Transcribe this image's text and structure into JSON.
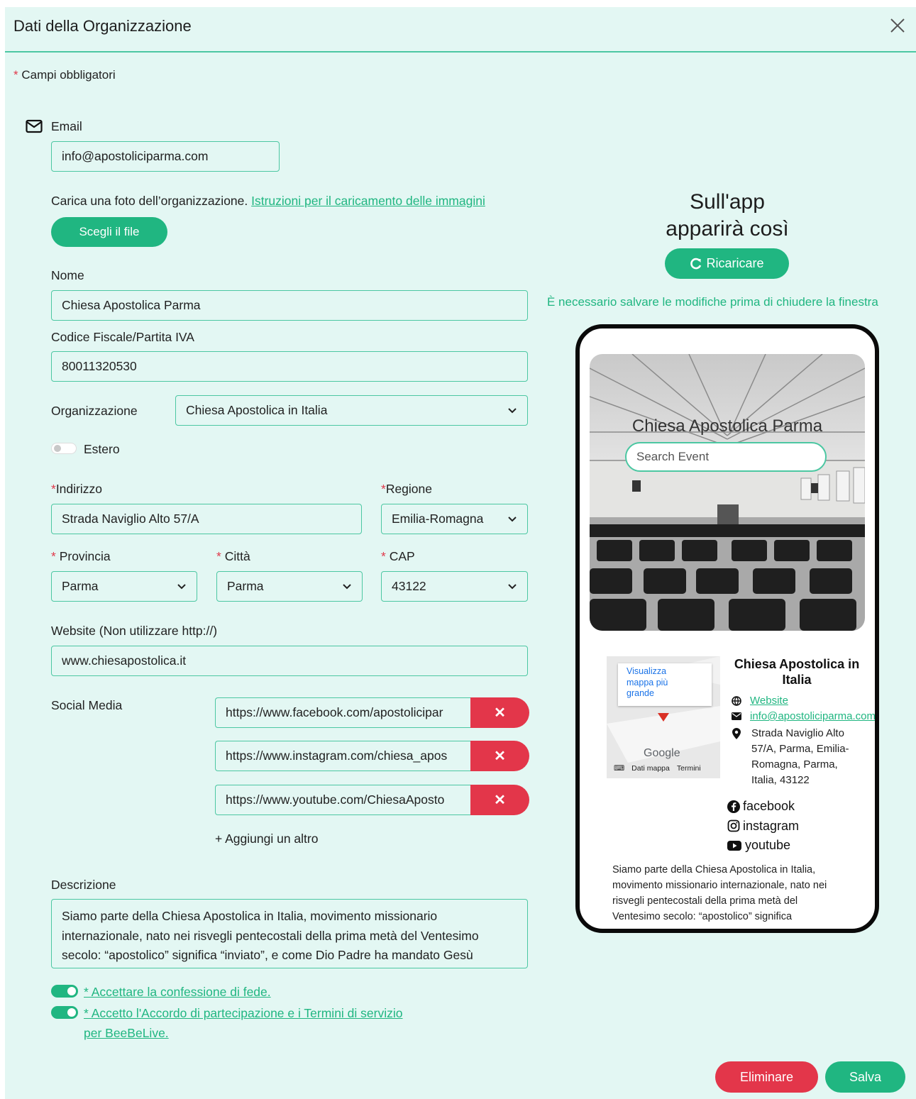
{
  "header": {
    "title": "Dati della Organizzazione"
  },
  "required_note": "Campi obbligatori",
  "email": {
    "label": "Email",
    "value": "info@apostoliciparma.com"
  },
  "photo": {
    "text": "Carica una foto dell’organizzazione.",
    "link": "Istruzioni per il caricamento delle immagini",
    "button": "Scegli il file"
  },
  "nome": {
    "label": "Nome",
    "value": "Chiesa Apostolica Parma"
  },
  "codice": {
    "label": "Codice Fiscale/Partita IVA",
    "value": "80011320530"
  },
  "organizzazione": {
    "label": "Organizzazione",
    "value": "Chiesa Apostolica in Italia"
  },
  "estero": {
    "label": "Estero",
    "on": false
  },
  "indirizzo": {
    "label": "Indirizzo",
    "value": "Strada Naviglio Alto 57/A"
  },
  "regione": {
    "label": "Regione",
    "value": "Emilia-Romagna"
  },
  "provincia": {
    "label": "Provincia",
    "value": "Parma"
  },
  "citta": {
    "label": "Città",
    "value": "Parma"
  },
  "cap": {
    "label": "CAP",
    "value": "43122"
  },
  "website": {
    "label": "Website (Non utilizzare http://)",
    "value": "www.chiesapostolica.it"
  },
  "social": {
    "label": "Social Media",
    "links": [
      "https://www.facebook.com/apostolicipar",
      "https://www.instagram.com/chiesa_apos",
      "https://www.youtube.com/ChiesaAposto"
    ],
    "remove": "✕",
    "add": "+ Aggiungi un altro"
  },
  "descrizione": {
    "label": "Descrizione",
    "lines": [
      "Siamo parte della Chiesa Apostolica in Italia, movimento missionario",
      "internazionale, nato nei risvegli pentecostali della prima metà del Ventesimo",
      "secolo: “apostolico” significa “inviato”, e come Dio Padre ha mandato Gesù"
    ]
  },
  "consents": {
    "faith": "* Accettare la confessione di fede.",
    "terms_line1": "* Accetto l'Accordo di partecipazione e i Termini di servizio",
    "terms_line2": "per BeeBeLive."
  },
  "preview": {
    "title_line1": "Sull'app",
    "title_line2": "apparirà così",
    "reload": "Ricaricare",
    "warning": "È necessario salvare le modifiche prima di chiudere la finestra",
    "phone": {
      "hero_title": "Chiesa Apostolica Parma",
      "search_placeholder": "Search Event",
      "map_link_1": "Visualizza",
      "map_link_2": "mappa più",
      "map_link_3": "grande",
      "map_google": "Google",
      "map_data": "Dati mappa",
      "map_terms": "Termini",
      "org_line1": "Chiesa Apostolica in",
      "org_line2": "Italia",
      "website": "Website",
      "email": "info@apostoliciparma.com",
      "address_lines": [
        "Strada Naviglio Alto",
        "57/A, Parma, Emilia-",
        "Romagna, Parma,",
        "Italia, 43122"
      ],
      "facebook": "facebook",
      "instagram": "instagram",
      "youtube": "youtube",
      "description_lines": [
        "Siamo parte della Chiesa Apostolica in Italia,",
        "movimento missionario internazionale, nato nei",
        "risvegli pentecostali della prima metà del",
        "Ventesimo secolo: “apostolico” significa"
      ]
    }
  },
  "footer": {
    "delete": "Eliminare",
    "save": "Salva"
  },
  "colors": {
    "accent": "#20b681",
    "danger": "#e3364a",
    "background": "#e3f7f3"
  }
}
